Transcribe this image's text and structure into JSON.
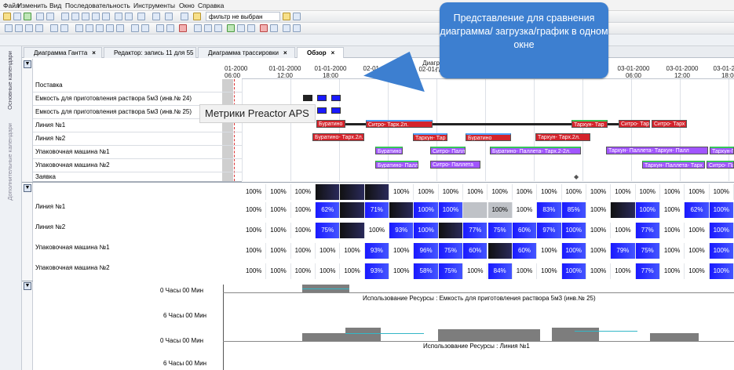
{
  "menu": [
    "Файл",
    "Изменить",
    "Вид",
    "Последовательность",
    "Инструменты",
    "Окно",
    "Справка"
  ],
  "toolbar": {
    "filter_value": "фильтр не выбран"
  },
  "tabs": [
    {
      "label": "Диаграмма Гантта"
    },
    {
      "label": "Редактор: запись 11 для 55"
    },
    {
      "label": "Диаграмма трассировки"
    },
    {
      "label": "Обзор"
    }
  ],
  "side_tabs": [
    "Основные календари",
    "Дополнительные календари"
  ],
  "timeline": {
    "center_label": "Диаграмма Га",
    "ticks": [
      {
        "d": "01-2000",
        "t": "06:00"
      },
      {
        "d": "01-01-2000",
        "t": "12:00"
      },
      {
        "d": "01-01-2000",
        "t": "18:00"
      },
      {
        "d": "02-01-2000",
        "t": "00:00"
      },
      {
        "d": "02-01-",
        "t": ""
      },
      {
        "d": "03-01-2000",
        "t": "06:00"
      },
      {
        "d": "03-01-2000",
        "t": "12:00"
      },
      {
        "d": "03-01-2000",
        "t": "18:00"
      }
    ]
  },
  "rows": [
    "Поставка",
    "Емкость для приготовления раствора 5м3 (инв.№ 24)",
    "Емкость для приготовления раствора 5м3 (инв.№ 25)",
    "Линия №1",
    "Линия №2",
    "Упаковочная машина №1",
    "Упаковочная машина №2",
    "Заявка"
  ],
  "bars": {
    "l1": [
      "Буратино",
      "Ситро- Тарх.2л.",
      "Тархун- Тар",
      "Ситро- Тарх",
      "Ситро- Тарх"
    ],
    "l2": [
      "Буратино- Тарх.2л.",
      "Тархун- Тар",
      "Буратино",
      "Тархун- Тарх.2л."
    ],
    "u1": [
      "Буратино",
      "Ситро- Палл",
      "Буратино- Паллета- Тарх.2-2л.",
      "Тархун- Паллета- Тархун- Палл",
      "Тархун-Палл"
    ],
    "u2": [
      "Буратино- Палл",
      "Ситро- Паллета",
      "Тархун- Паллета- Тарх",
      "Ситро- Па"
    ]
  },
  "load": {
    "row0": [
      "100%",
      "100%",
      "100%",
      "",
      "",
      "",
      "100%",
      "100%",
      "100%",
      "100%",
      "100%",
      "100%",
      "100%",
      "100%",
      "100%",
      "100%",
      "100%",
      "100%",
      "100%",
      "100%"
    ],
    "l1_label": "Линия №1",
    "l1": [
      "100%",
      "100%",
      "100%",
      "62%",
      "",
      "71%",
      "",
      "100%",
      "100%",
      "",
      "100%",
      "100%",
      "83%",
      "85%",
      "100%",
      "",
      "100%",
      "100%",
      "62%",
      "100%"
    ],
    "l2_label": "Линия №2",
    "l2": [
      "100%",
      "100%",
      "100%",
      "75%",
      "",
      "100%",
      "93%",
      "100%",
      "",
      "77%",
      "75%",
      "60%",
      "97%",
      "100%",
      "100%",
      "100%",
      "77%",
      "100%",
      "100%",
      "100%"
    ],
    "u1_label": "Упаковочная машина №1",
    "u1": [
      "100%",
      "100%",
      "100%",
      "100%",
      "100%",
      "93%",
      "100%",
      "96%",
      "75%",
      "60%",
      "",
      "60%",
      "100%",
      "100%",
      "100%",
      "79%",
      "75%",
      "100%",
      "100%",
      "100%"
    ],
    "u2_label": "Упаковочная машина №2",
    "u2": [
      "100%",
      "100%",
      "100%",
      "100%",
      "100%",
      "93%",
      "100%",
      "58%",
      "75%",
      "100%",
      "84%",
      "100%",
      "100%",
      "100%",
      "100%",
      "100%",
      "77%",
      "100%",
      "100%",
      "100%"
    ]
  },
  "usage": {
    "y0a": "0 Часы 00 Мин",
    "title1": "Использование Ресурсы : Емкость для приготовления раствора 5м3 (инв.№ 25)",
    "y6a": "6 Часы 00 Мин",
    "y0b": "0 Часы 00 Мин",
    "title2": "Использование Ресурсы : Линия №1",
    "y6b": "6 Часы 00 Мин"
  },
  "callout": {
    "text": "Представление для сравнения диаграмма/ загрузка/график в одном окне"
  },
  "metrics": {
    "text": "Метрики Preactor APS"
  },
  "colors": {
    "blue": "#1a1aff",
    "red": "#d4232b",
    "callout": "#3d7fd0"
  }
}
